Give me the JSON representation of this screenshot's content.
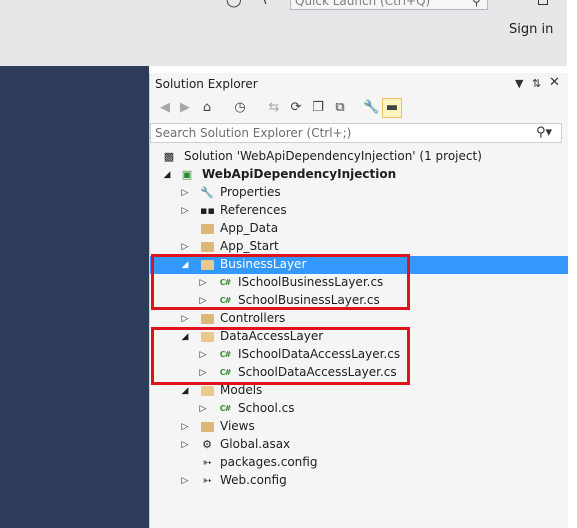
{
  "top_bar": {
    "quick_launch_placeholder": "Quick Launch (Ctrl+Q)",
    "sign_in": "Sign in"
  },
  "solution_explorer": {
    "title": "Solution Explorer",
    "header_buttons": [
      "dropdown-icon",
      "pin-icon",
      "close-icon"
    ],
    "toolbar_icons": [
      "back-icon",
      "forward-icon",
      "home-icon",
      "history-icon",
      "sync-icon",
      "refresh-icon",
      "collapse-all-icon",
      "show-all-files-icon",
      "properties-icon",
      "preview-icon"
    ],
    "search_placeholder": "Search Solution Explorer (Ctrl+;)"
  },
  "tree": [
    {
      "label": "Solution 'WebApiDependencyInjection' (1 project)",
      "level": 0,
      "expander": "none",
      "icon": "solution-icon",
      "bold": false,
      "selected": false
    },
    {
      "label": "WebApiDependencyInjection",
      "level": 1,
      "expander": "expanded",
      "icon": "web-project-icon",
      "bold": true,
      "selected": false
    },
    {
      "label": "Properties",
      "level": 2,
      "expander": "collapsed",
      "icon": "wrench-icon",
      "bold": false,
      "selected": false
    },
    {
      "label": "References",
      "level": 2,
      "expander": "collapsed",
      "icon": "references-icon",
      "bold": false,
      "selected": false
    },
    {
      "label": "App_Data",
      "level": 2,
      "expander": "none",
      "icon": "folder-icon",
      "bold": false,
      "selected": false
    },
    {
      "label": "App_Start",
      "level": 2,
      "expander": "collapsed",
      "icon": "folder-icon",
      "bold": false,
      "selected": false
    },
    {
      "label": "BusinessLayer",
      "level": 2,
      "expander": "expanded",
      "icon": "open-folder-icon",
      "bold": false,
      "selected": true
    },
    {
      "label": "ISchoolBusinessLayer.cs",
      "level": 3,
      "expander": "collapsed",
      "icon": "csharp-file-icon",
      "bold": false,
      "selected": false
    },
    {
      "label": "SchoolBusinessLayer.cs",
      "level": 3,
      "expander": "collapsed",
      "icon": "csharp-file-icon",
      "bold": false,
      "selected": false
    },
    {
      "label": "Controllers",
      "level": 2,
      "expander": "collapsed",
      "icon": "folder-icon",
      "bold": false,
      "selected": false
    },
    {
      "label": "DataAccessLayer",
      "level": 2,
      "expander": "expanded",
      "icon": "open-folder-icon",
      "bold": false,
      "selected": false
    },
    {
      "label": "ISchoolDataAccessLayer.cs",
      "level": 3,
      "expander": "collapsed",
      "icon": "csharp-file-icon",
      "bold": false,
      "selected": false
    },
    {
      "label": "SchoolDataAccessLayer.cs",
      "level": 3,
      "expander": "collapsed",
      "icon": "csharp-file-icon",
      "bold": false,
      "selected": false
    },
    {
      "label": "Models",
      "level": 2,
      "expander": "expanded",
      "icon": "open-folder-icon",
      "bold": false,
      "selected": false
    },
    {
      "label": "School.cs",
      "level": 3,
      "expander": "collapsed",
      "icon": "csharp-file-icon",
      "bold": false,
      "selected": false
    },
    {
      "label": "Views",
      "level": 2,
      "expander": "collapsed",
      "icon": "folder-icon",
      "bold": false,
      "selected": false
    },
    {
      "label": "Global.asax",
      "level": 2,
      "expander": "collapsed",
      "icon": "global-asax-icon",
      "bold": false,
      "selected": false
    },
    {
      "label": "packages.config",
      "level": 2,
      "expander": "none",
      "icon": "config-file-icon",
      "bold": false,
      "selected": false
    },
    {
      "label": "Web.config",
      "level": 2,
      "expander": "collapsed",
      "icon": "config-file-icon",
      "bold": false,
      "selected": false
    }
  ],
  "annotations": {
    "highlight_color": "#e0121b",
    "highlighted_groups": [
      "BusinessLayer",
      "DataAccessLayer"
    ]
  },
  "colors": {
    "selection": "#3399ff",
    "panel_bg": "#f5f5f5",
    "dark_bg": "#2d3d59",
    "csharp_badge": "#388a34"
  }
}
